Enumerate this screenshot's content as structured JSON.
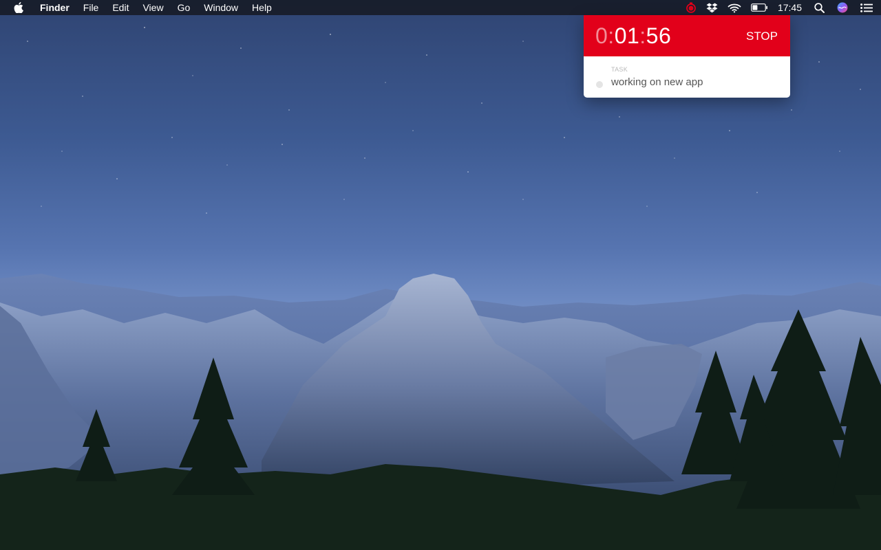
{
  "menubar": {
    "app_name": "Finder",
    "items": [
      "File",
      "Edit",
      "View",
      "Go",
      "Window",
      "Help"
    ],
    "status_icons": [
      "timer-icon",
      "dropbox-icon",
      "wifi-icon",
      "battery-icon"
    ],
    "clock": "17:45",
    "right_icons": [
      "spotlight-icon",
      "siri-icon",
      "notification-center-icon"
    ]
  },
  "timer": {
    "hours": "0",
    "sep1": ":",
    "minutes": "01",
    "sep2": ":",
    "seconds": "56",
    "stop_label": "STOP",
    "task_label": "TASK",
    "task_name": "working on new app",
    "accent_color": "#e2001a"
  }
}
